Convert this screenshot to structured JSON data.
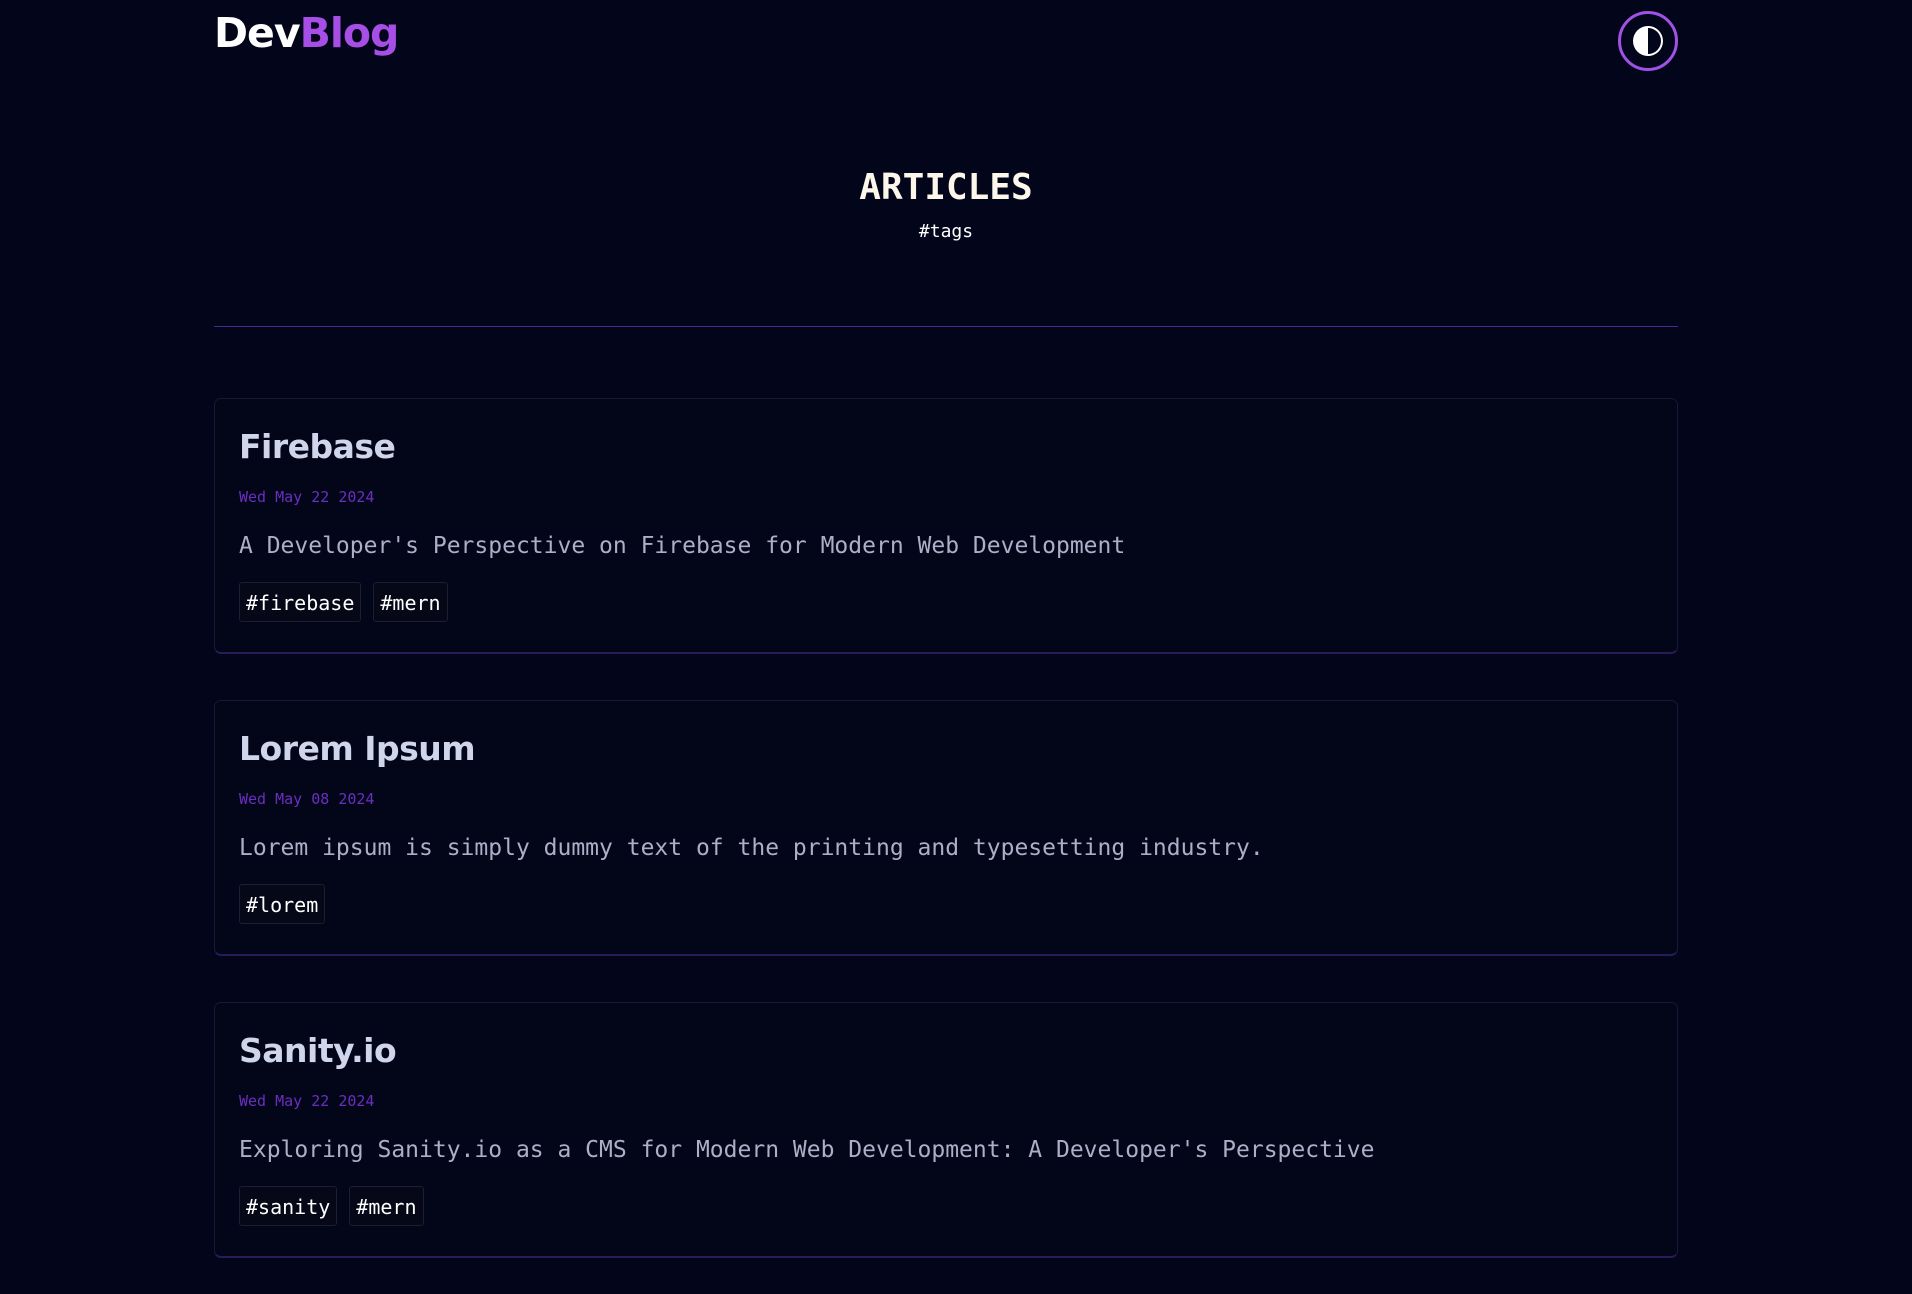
{
  "header": {
    "logo_part1": "Dev",
    "logo_part2": "Blog",
    "theme_toggle_icon": "contrast-icon",
    "accent_color": "#a64ee6"
  },
  "page": {
    "title": "ARTICLES",
    "subtitle": "#tags"
  },
  "articles": [
    {
      "title": "Firebase",
      "date": "Wed May 22 2024",
      "description": "A Developer's Perspective on Firebase for Modern Web Development",
      "tags": [
        "#firebase",
        "#mern"
      ]
    },
    {
      "title": "Lorem Ipsum",
      "date": "Wed May 08 2024",
      "description": "Lorem ipsum is simply dummy text of the printing and typesetting industry.",
      "tags": [
        "#lorem"
      ]
    },
    {
      "title": "Sanity.io",
      "date": "Wed May 22 2024",
      "description": "Exploring Sanity.io as a CMS for Modern Web Development: A Developer's Perspective",
      "tags": [
        "#sanity",
        "#mern"
      ]
    }
  ]
}
